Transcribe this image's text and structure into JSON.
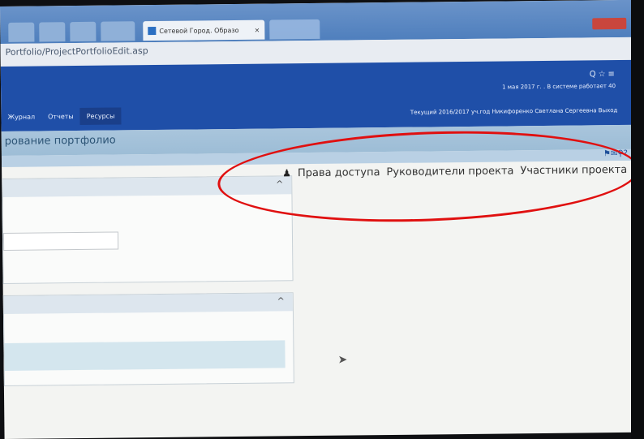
{
  "browser": {
    "active_tab_title": "Сетевой Город. Образо",
    "tab_close": "×",
    "address": "Portfolio/ProjectPortfolioEdit.asp"
  },
  "header": {
    "top_icons": "Q☆≡",
    "date_line": "1 мая 2017 г. . В системе работает 40",
    "menu": [
      "Журнал",
      "Отчеты",
      "Ресурсы"
    ],
    "user_line": "Текущий 2016/2017 уч.год  Никифоренко Светлана Сергеевна  Выход"
  },
  "page": {
    "title": "рование портфолио",
    "tool_icons": "⚑✉⚲?"
  },
  "panels": [
    {
      "chevron": "^"
    },
    {
      "chevron": "^"
    }
  ],
  "access_tabs": {
    "rights": "Права доступа",
    "leaders": "Руководители проекта",
    "members": "Участники проекта"
  },
  "colors": {
    "header": "#1f4fa8",
    "title_bar": "#a9c5dc",
    "highlight_ellipse": "#e01010"
  }
}
